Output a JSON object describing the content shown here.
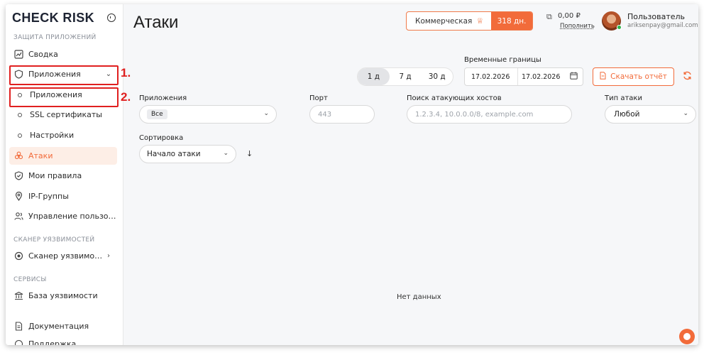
{
  "brand": {
    "logo_text_1": "CHECK",
    "logo_text_2": "RISK"
  },
  "sidebar": {
    "sections": {
      "app_protection": "ЗАЩИТА ПРИЛОЖЕНИЙ",
      "vuln_scanner": "СКАНЕР УЯЗВИМОСТЕЙ",
      "services": "СЕРВИСЫ"
    },
    "items": {
      "summary": "Сводка",
      "apps_group": "Приложения",
      "apps": "Приложения",
      "ssl": "SSL сертификаты",
      "settings": "Настройки",
      "attacks": "Атаки",
      "rules": "Мои правила",
      "ip_groups": "IP-Группы",
      "users": "Управление пользов...",
      "scanner": "Сканер уязвимосте...",
      "vuln_db": "База уязвимости",
      "docs": "Документация",
      "support": "Поддержка"
    },
    "annotations": {
      "one": "1.",
      "two": "2."
    }
  },
  "header": {
    "title": "Атаки",
    "plan_name": "Коммерческая",
    "plan_days": "318 дн.",
    "balance": "0,00 ₽",
    "top_up": "Пополнить",
    "user_name": "Пользователь",
    "user_email": "ariksenpay@gmail.com"
  },
  "filters": {
    "time_bounds_label": "Временные границы",
    "periods": [
      "1 д",
      "7 д",
      "30 д"
    ],
    "active_period": "1 д",
    "date_from": "17.02.2026",
    "date_to": "17.02.2026",
    "download_label": "Скачать отчёт",
    "apps_label": "Приложения",
    "apps_value": "Все",
    "port_label": "Порт",
    "port_placeholder": "443",
    "hosts_label": "Поиск атакующих хостов",
    "hosts_placeholder": "1.2.3.4, 10.0.0.0/8, example.com",
    "attack_type_label": "Тип атаки",
    "attack_type_value": "Любой",
    "sort_label": "Сортировка",
    "sort_value": "Начало атаки"
  },
  "content": {
    "empty_text": "Нет данных"
  },
  "colors": {
    "accent": "#f26b3a",
    "annotation": "#e02020"
  }
}
